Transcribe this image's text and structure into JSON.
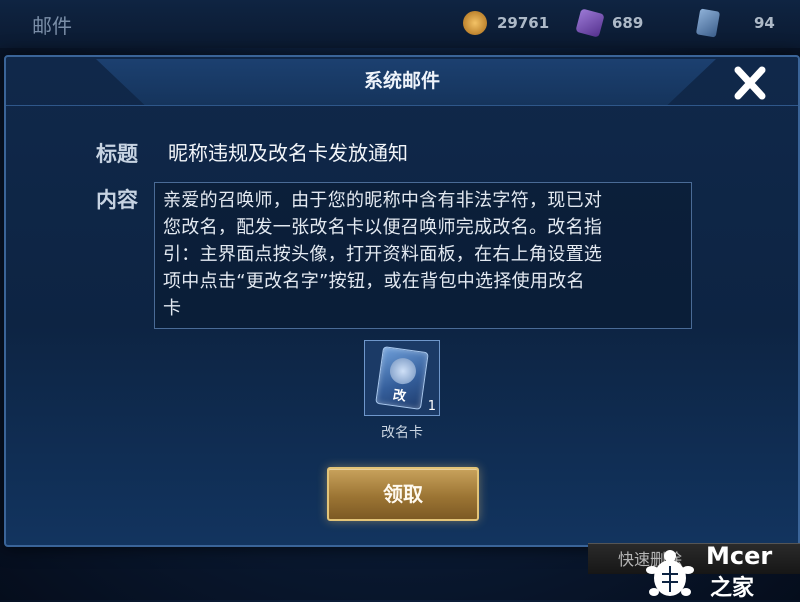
{
  "background": {
    "title": "邮件",
    "resources": [
      {
        "name": "gold-coin",
        "value": "29761"
      },
      {
        "name": "gem",
        "value": "689"
      },
      {
        "name": "voucher",
        "value": "94"
      }
    ],
    "quick_delete_label": "快速删除"
  },
  "dialog": {
    "title": "系统邮件",
    "subject_label": "标题",
    "subject": "昵称违规及改名卡发放通知",
    "content_label": "内容",
    "content_lines": [
      "亲爱的召唤师，由于您的昵称中含有非法字符，现已对",
      "您改名，配发一张改名卡以便召唤师完成改名。改名指",
      "引：主界面点按头像，打开资料面板，在右上角设置选",
      "项中点击“更改名字”按钮，或在背包中选择使用改名",
      "卡"
    ],
    "attachment": {
      "icon": "rename-card-icon",
      "glyph": "改",
      "count": "1",
      "name": "改名卡"
    },
    "claim_label": "领取",
    "close_icon": "close-icon"
  },
  "watermark": {
    "line1": "Mcer",
    "line2": "之家"
  },
  "colors": {
    "accent_gold": "#c8a25c",
    "panel_border": "#3a6498",
    "dialog_bg": "#10284a"
  }
}
